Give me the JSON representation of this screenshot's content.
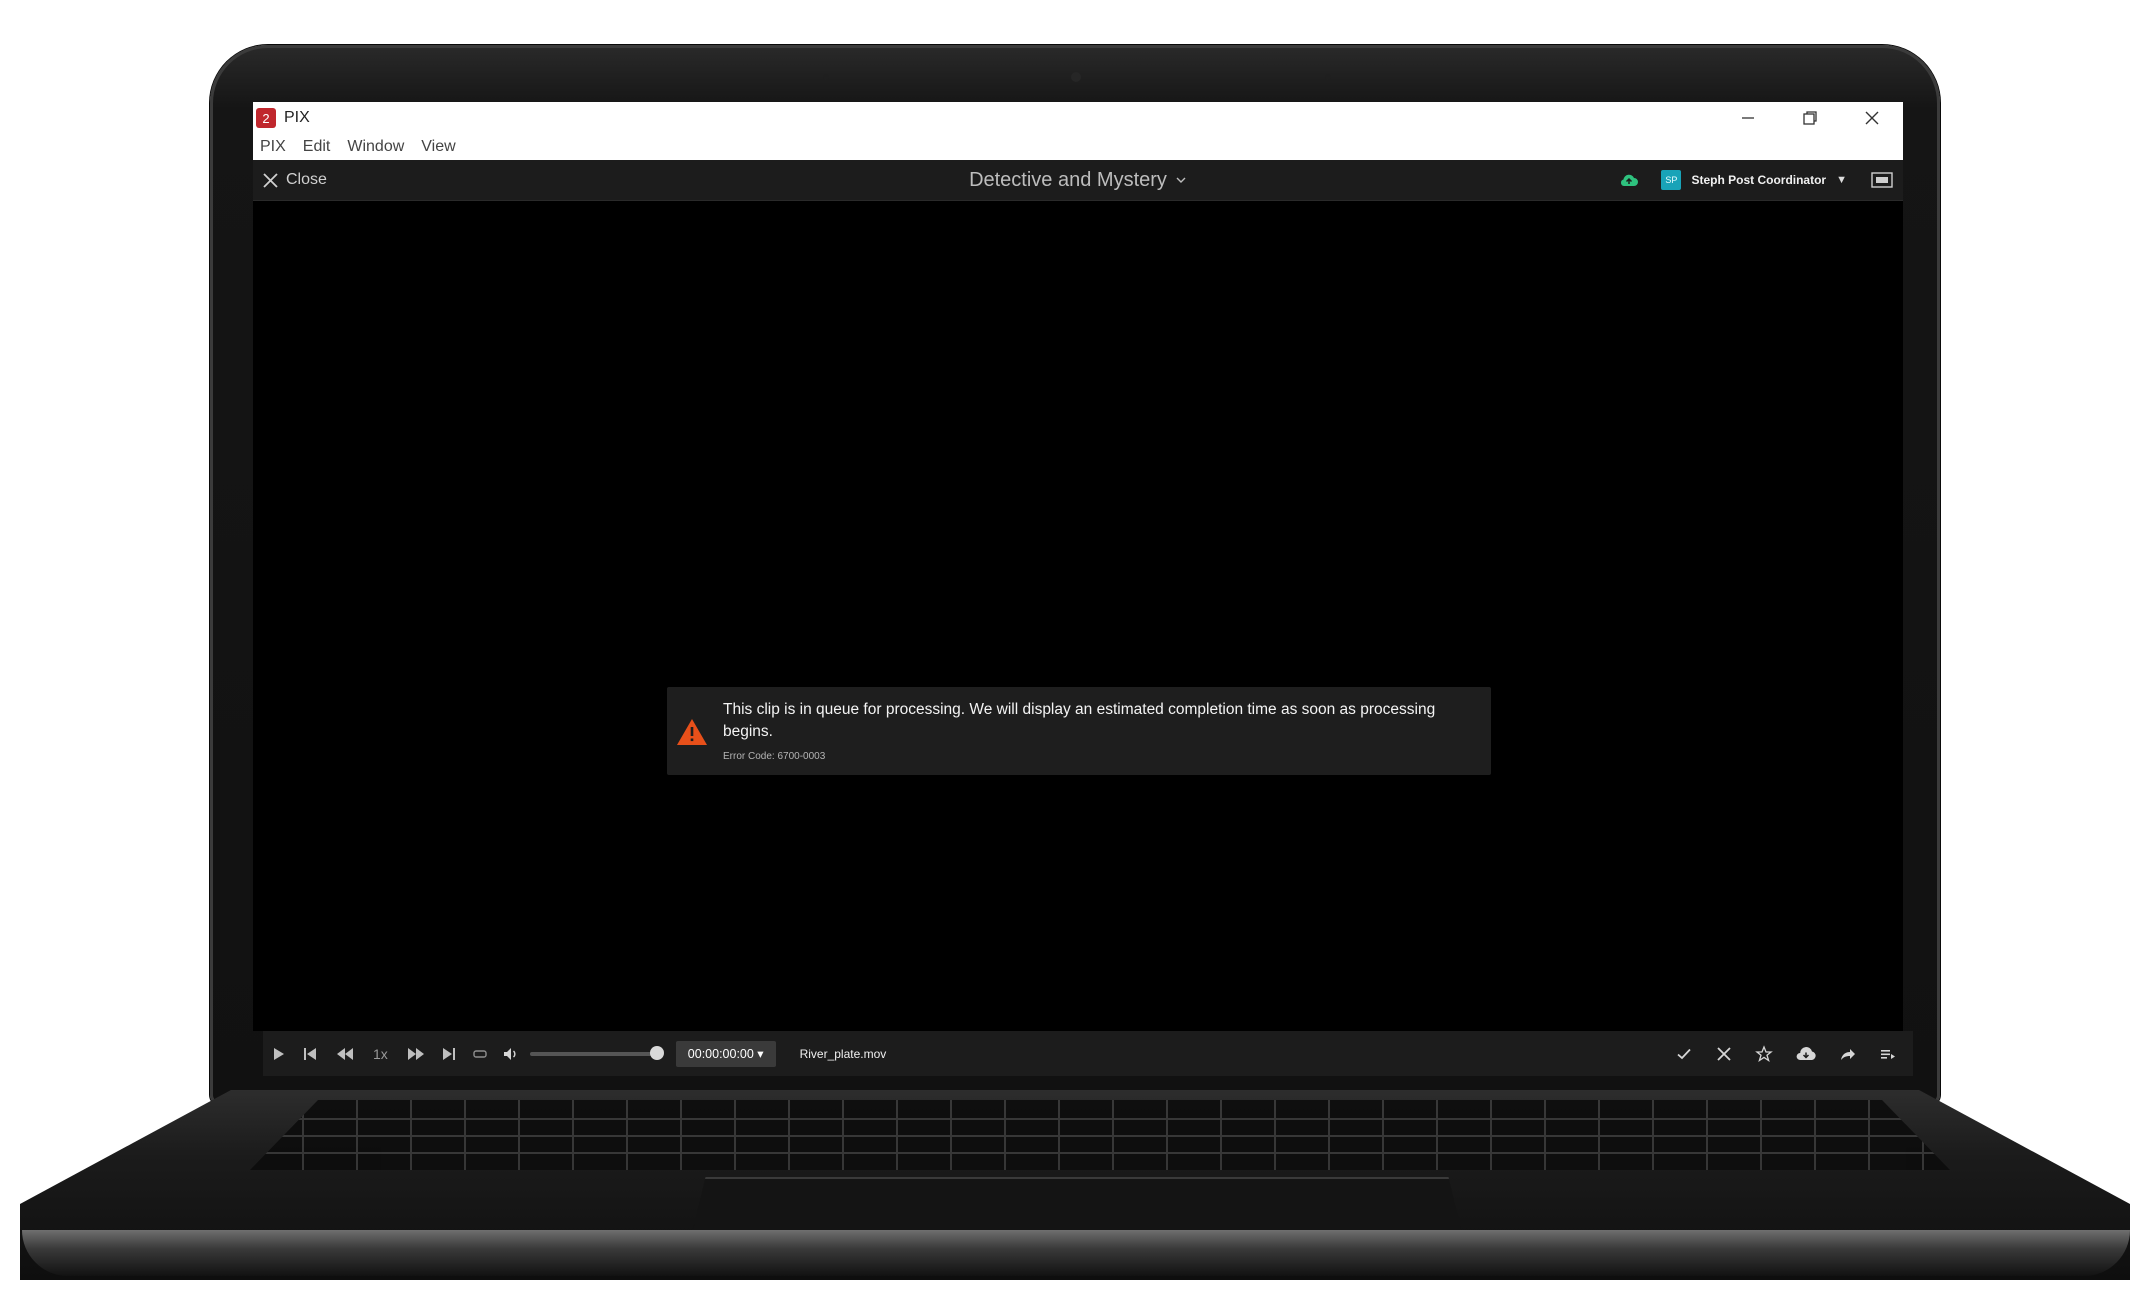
{
  "app": {
    "icon_text": "2",
    "title": "PIX",
    "menu": [
      "PIX",
      "Edit",
      "Window",
      "View"
    ]
  },
  "topbar": {
    "close_label": "Close",
    "project_title": "Detective and Mystery",
    "user_initials": "SP",
    "user_name": "Steph Post Coordinator",
    "user_caret": "▼"
  },
  "notice": {
    "message": "This clip is in queue for processing. We will display an estimated completion time as soon as processing begins.",
    "error_code": "Error Code: 6700-0003"
  },
  "player": {
    "speed": "1x",
    "timecode": "00:00:00:00 ▾",
    "clip_name": "River_plate.mov",
    "volume_level": 1.0
  },
  "colors": {
    "accent_red": "#c0272d",
    "cloud_green": "#2ec27e",
    "avatar_teal": "#19a3b8",
    "warning_orange": "#e8501a"
  },
  "icons": {
    "window": [
      "minimize-icon",
      "restore-icon",
      "close-window-icon"
    ],
    "player_left": [
      "play-icon",
      "skip-start-icon",
      "step-back-icon",
      "step-forward-icon",
      "skip-end-icon",
      "loop-icon",
      "volume-icon"
    ],
    "player_right": [
      "approve-check-icon",
      "reject-x-icon",
      "star-icon",
      "download-cloud-icon",
      "share-arrow-icon",
      "playlist-icon"
    ]
  }
}
